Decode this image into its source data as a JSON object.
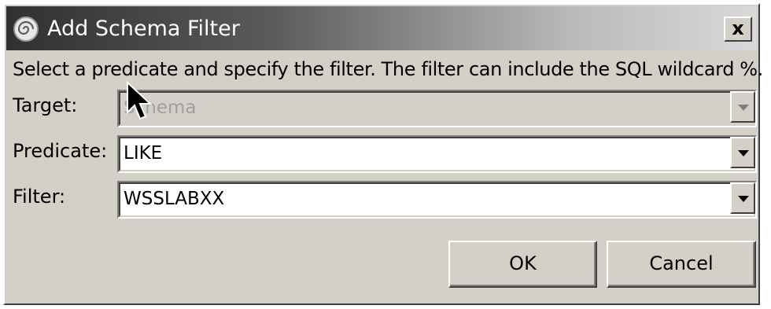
{
  "window": {
    "title": "Add Schema Filter",
    "close_label": "x"
  },
  "instructions": "Select a predicate and specify the filter. The filter can include the SQL wildcard %.",
  "fields": {
    "target": {
      "label": "Target:",
      "value": "Schema",
      "enabled": false
    },
    "predicate": {
      "label": "Predicate:",
      "value": "LIKE",
      "enabled": true
    },
    "filter": {
      "label": "Filter:",
      "value": "WSSLABXX",
      "enabled": true
    }
  },
  "buttons": {
    "ok": "OK",
    "cancel": "Cancel"
  },
  "icons": {
    "app": "swirl-app-icon",
    "close": "close-icon",
    "dropdown": "chevron-down-icon",
    "cursor": "mouse-pointer-icon"
  },
  "colors": {
    "dialog_background": "#d4d0c8",
    "title_gradient_start": "#303030",
    "title_gradient_end": "#d9d9d9",
    "disabled_text": "#a0a0a0"
  }
}
